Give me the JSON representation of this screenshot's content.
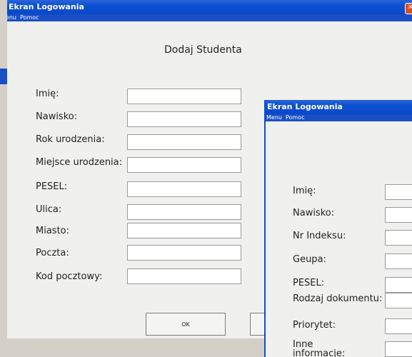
{
  "window1": {
    "title": "Ekran Logowania",
    "menu": [
      "Menu",
      "Pomoc"
    ],
    "heading": "Dodaj Studenta",
    "fields": [
      {
        "label": "Imię:",
        "value": ""
      },
      {
        "label": "Nawisko:",
        "value": ""
      },
      {
        "label": "Rok urodzenia:",
        "value": ""
      },
      {
        "label": "Miejsce urodzenia:",
        "value": ""
      },
      {
        "label": "PESEL:",
        "value": ""
      },
      {
        "label": "Ulica:",
        "value": ""
      },
      {
        "label": "Miasto:",
        "value": ""
      },
      {
        "label": "Poczta:",
        "value": ""
      },
      {
        "label": "Kod pocztowy:",
        "value": ""
      }
    ],
    "ok_label": "OK"
  },
  "window2": {
    "title": "Ekran Logowania",
    "menu": [
      "Menu",
      "Pomoc"
    ],
    "fields": [
      {
        "label": "Imię:",
        "value": ""
      },
      {
        "label": "Nawisko:",
        "value": ""
      },
      {
        "label": "Nr Indeksu:",
        "value": ""
      },
      {
        "label": "Geupa:",
        "value": ""
      },
      {
        "label": "PESEL:",
        "value": ""
      },
      {
        "label": "Rodzaj dokumentu:",
        "value": ""
      },
      {
        "label": "Priorytet:",
        "value": ""
      },
      {
        "label": "Inne informacje:",
        "value": ""
      }
    ]
  },
  "colors": {
    "titlebar": "#0a50d2",
    "window_bg": "#f0f0ee",
    "close": "#d8502a"
  },
  "icons": [
    "close-icon"
  ]
}
